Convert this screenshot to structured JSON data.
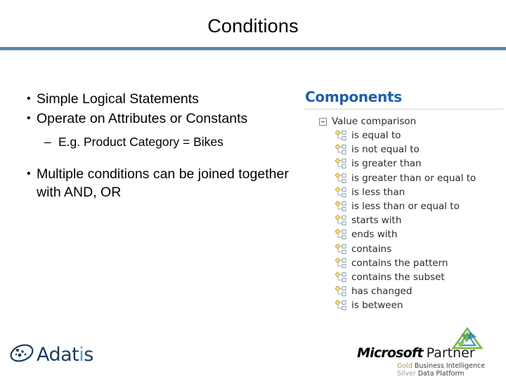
{
  "slide": {
    "title": "Conditions",
    "accent_color": "#5b83a8"
  },
  "content": {
    "bullet_marker": "•",
    "dash_marker": "–",
    "bullets": [
      {
        "text": "Simple Logical Statements"
      },
      {
        "text": "Operate on Attributes or Constants"
      }
    ],
    "sub_bullet": {
      "text": "E.g. Product Category = Bikes"
    },
    "final_bullet": {
      "text": "Multiple conditions can be joined together with AND, OR"
    }
  },
  "panel": {
    "heading": "Components",
    "heading_color": "#1f5fa9",
    "tree": {
      "root_label": "Value comparison",
      "expander_state": "expanded",
      "items": [
        "is equal to",
        "is not equal to",
        "is greater than",
        "is greater than or equal to",
        "is less than",
        "is less than or equal to",
        "starts with",
        "ends with",
        "contains",
        "contains the pattern",
        "contains the subset",
        "has changed",
        "is between"
      ]
    }
  },
  "footer": {
    "adatis": {
      "name_start": "Adat",
      "name_accent": "i",
      "name_end": "s",
      "logo_color": "#1b3d5c",
      "accent_color": "#4f9ec9"
    },
    "microsoft": {
      "brand": "Microsoft",
      "program": "Partner",
      "competency_gold_level": "Gold",
      "competency_gold_name": "Business Intelligence",
      "competency_silver_level": "Silver",
      "competency_silver_name": "Data Platform"
    }
  }
}
